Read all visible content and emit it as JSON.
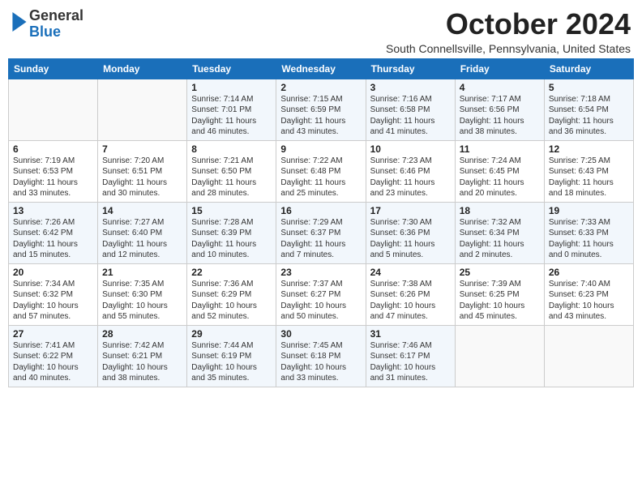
{
  "header": {
    "logo_general": "General",
    "logo_blue": "Blue",
    "month_title": "October 2024",
    "location": "South Connellsville, Pennsylvania, United States"
  },
  "days_of_week": [
    "Sunday",
    "Monday",
    "Tuesday",
    "Wednesday",
    "Thursday",
    "Friday",
    "Saturday"
  ],
  "weeks": [
    [
      {
        "day": "",
        "detail": ""
      },
      {
        "day": "",
        "detail": ""
      },
      {
        "day": "1",
        "detail": "Sunrise: 7:14 AM\nSunset: 7:01 PM\nDaylight: 11 hours and 46 minutes."
      },
      {
        "day": "2",
        "detail": "Sunrise: 7:15 AM\nSunset: 6:59 PM\nDaylight: 11 hours and 43 minutes."
      },
      {
        "day": "3",
        "detail": "Sunrise: 7:16 AM\nSunset: 6:58 PM\nDaylight: 11 hours and 41 minutes."
      },
      {
        "day": "4",
        "detail": "Sunrise: 7:17 AM\nSunset: 6:56 PM\nDaylight: 11 hours and 38 minutes."
      },
      {
        "day": "5",
        "detail": "Sunrise: 7:18 AM\nSunset: 6:54 PM\nDaylight: 11 hours and 36 minutes."
      }
    ],
    [
      {
        "day": "6",
        "detail": "Sunrise: 7:19 AM\nSunset: 6:53 PM\nDaylight: 11 hours and 33 minutes."
      },
      {
        "day": "7",
        "detail": "Sunrise: 7:20 AM\nSunset: 6:51 PM\nDaylight: 11 hours and 30 minutes."
      },
      {
        "day": "8",
        "detail": "Sunrise: 7:21 AM\nSunset: 6:50 PM\nDaylight: 11 hours and 28 minutes."
      },
      {
        "day": "9",
        "detail": "Sunrise: 7:22 AM\nSunset: 6:48 PM\nDaylight: 11 hours and 25 minutes."
      },
      {
        "day": "10",
        "detail": "Sunrise: 7:23 AM\nSunset: 6:46 PM\nDaylight: 11 hours and 23 minutes."
      },
      {
        "day": "11",
        "detail": "Sunrise: 7:24 AM\nSunset: 6:45 PM\nDaylight: 11 hours and 20 minutes."
      },
      {
        "day": "12",
        "detail": "Sunrise: 7:25 AM\nSunset: 6:43 PM\nDaylight: 11 hours and 18 minutes."
      }
    ],
    [
      {
        "day": "13",
        "detail": "Sunrise: 7:26 AM\nSunset: 6:42 PM\nDaylight: 11 hours and 15 minutes."
      },
      {
        "day": "14",
        "detail": "Sunrise: 7:27 AM\nSunset: 6:40 PM\nDaylight: 11 hours and 12 minutes."
      },
      {
        "day": "15",
        "detail": "Sunrise: 7:28 AM\nSunset: 6:39 PM\nDaylight: 11 hours and 10 minutes."
      },
      {
        "day": "16",
        "detail": "Sunrise: 7:29 AM\nSunset: 6:37 PM\nDaylight: 11 hours and 7 minutes."
      },
      {
        "day": "17",
        "detail": "Sunrise: 7:30 AM\nSunset: 6:36 PM\nDaylight: 11 hours and 5 minutes."
      },
      {
        "day": "18",
        "detail": "Sunrise: 7:32 AM\nSunset: 6:34 PM\nDaylight: 11 hours and 2 minutes."
      },
      {
        "day": "19",
        "detail": "Sunrise: 7:33 AM\nSunset: 6:33 PM\nDaylight: 11 hours and 0 minutes."
      }
    ],
    [
      {
        "day": "20",
        "detail": "Sunrise: 7:34 AM\nSunset: 6:32 PM\nDaylight: 10 hours and 57 minutes."
      },
      {
        "day": "21",
        "detail": "Sunrise: 7:35 AM\nSunset: 6:30 PM\nDaylight: 10 hours and 55 minutes."
      },
      {
        "day": "22",
        "detail": "Sunrise: 7:36 AM\nSunset: 6:29 PM\nDaylight: 10 hours and 52 minutes."
      },
      {
        "day": "23",
        "detail": "Sunrise: 7:37 AM\nSunset: 6:27 PM\nDaylight: 10 hours and 50 minutes."
      },
      {
        "day": "24",
        "detail": "Sunrise: 7:38 AM\nSunset: 6:26 PM\nDaylight: 10 hours and 47 minutes."
      },
      {
        "day": "25",
        "detail": "Sunrise: 7:39 AM\nSunset: 6:25 PM\nDaylight: 10 hours and 45 minutes."
      },
      {
        "day": "26",
        "detail": "Sunrise: 7:40 AM\nSunset: 6:23 PM\nDaylight: 10 hours and 43 minutes."
      }
    ],
    [
      {
        "day": "27",
        "detail": "Sunrise: 7:41 AM\nSunset: 6:22 PM\nDaylight: 10 hours and 40 minutes."
      },
      {
        "day": "28",
        "detail": "Sunrise: 7:42 AM\nSunset: 6:21 PM\nDaylight: 10 hours and 38 minutes."
      },
      {
        "day": "29",
        "detail": "Sunrise: 7:44 AM\nSunset: 6:19 PM\nDaylight: 10 hours and 35 minutes."
      },
      {
        "day": "30",
        "detail": "Sunrise: 7:45 AM\nSunset: 6:18 PM\nDaylight: 10 hours and 33 minutes."
      },
      {
        "day": "31",
        "detail": "Sunrise: 7:46 AM\nSunset: 6:17 PM\nDaylight: 10 hours and 31 minutes."
      },
      {
        "day": "",
        "detail": ""
      },
      {
        "day": "",
        "detail": ""
      }
    ]
  ]
}
